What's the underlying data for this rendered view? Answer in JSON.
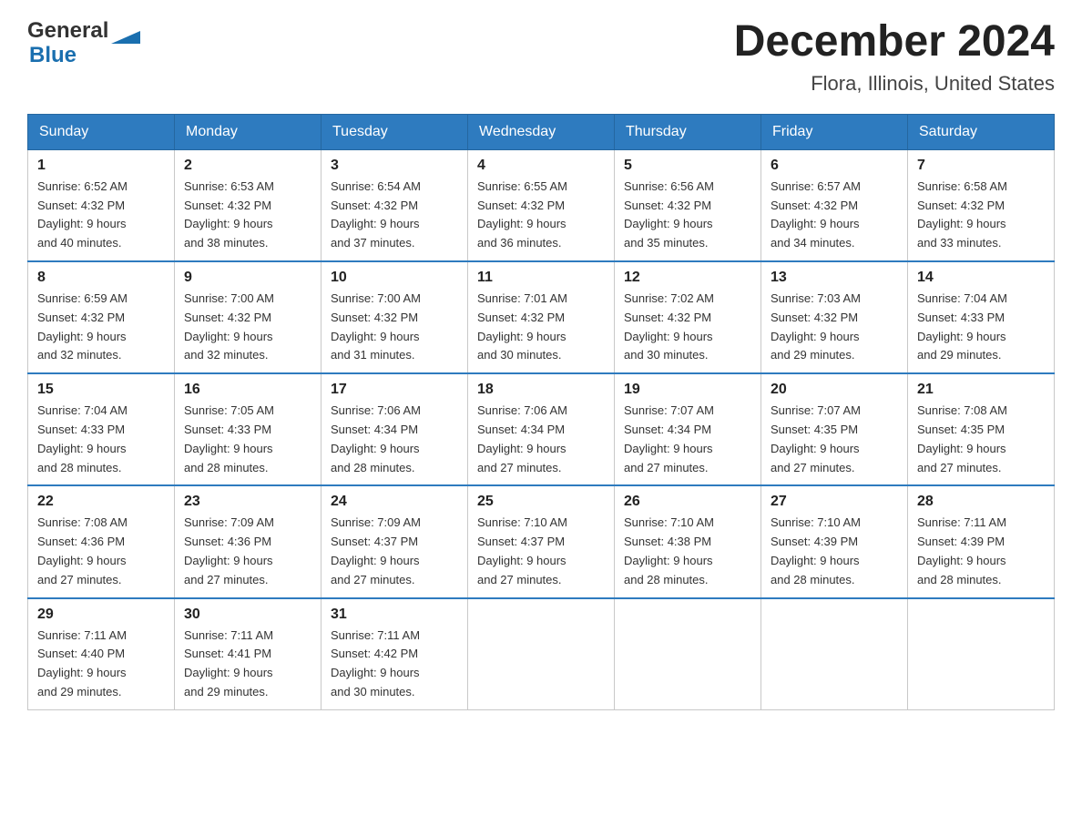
{
  "logo": {
    "text_general": "General",
    "text_blue": "Blue"
  },
  "title": {
    "month": "December 2024",
    "location": "Flora, Illinois, United States"
  },
  "weekdays": [
    "Sunday",
    "Monday",
    "Tuesday",
    "Wednesday",
    "Thursday",
    "Friday",
    "Saturday"
  ],
  "weeks": [
    [
      {
        "day": "1",
        "sunrise": "6:52 AM",
        "sunset": "4:32 PM",
        "daylight": "9 hours and 40 minutes."
      },
      {
        "day": "2",
        "sunrise": "6:53 AM",
        "sunset": "4:32 PM",
        "daylight": "9 hours and 38 minutes."
      },
      {
        "day": "3",
        "sunrise": "6:54 AM",
        "sunset": "4:32 PM",
        "daylight": "9 hours and 37 minutes."
      },
      {
        "day": "4",
        "sunrise": "6:55 AM",
        "sunset": "4:32 PM",
        "daylight": "9 hours and 36 minutes."
      },
      {
        "day": "5",
        "sunrise": "6:56 AM",
        "sunset": "4:32 PM",
        "daylight": "9 hours and 35 minutes."
      },
      {
        "day": "6",
        "sunrise": "6:57 AM",
        "sunset": "4:32 PM",
        "daylight": "9 hours and 34 minutes."
      },
      {
        "day": "7",
        "sunrise": "6:58 AM",
        "sunset": "4:32 PM",
        "daylight": "9 hours and 33 minutes."
      }
    ],
    [
      {
        "day": "8",
        "sunrise": "6:59 AM",
        "sunset": "4:32 PM",
        "daylight": "9 hours and 32 minutes."
      },
      {
        "day": "9",
        "sunrise": "7:00 AM",
        "sunset": "4:32 PM",
        "daylight": "9 hours and 32 minutes."
      },
      {
        "day": "10",
        "sunrise": "7:00 AM",
        "sunset": "4:32 PM",
        "daylight": "9 hours and 31 minutes."
      },
      {
        "day": "11",
        "sunrise": "7:01 AM",
        "sunset": "4:32 PM",
        "daylight": "9 hours and 30 minutes."
      },
      {
        "day": "12",
        "sunrise": "7:02 AM",
        "sunset": "4:32 PM",
        "daylight": "9 hours and 30 minutes."
      },
      {
        "day": "13",
        "sunrise": "7:03 AM",
        "sunset": "4:32 PM",
        "daylight": "9 hours and 29 minutes."
      },
      {
        "day": "14",
        "sunrise": "7:04 AM",
        "sunset": "4:33 PM",
        "daylight": "9 hours and 29 minutes."
      }
    ],
    [
      {
        "day": "15",
        "sunrise": "7:04 AM",
        "sunset": "4:33 PM",
        "daylight": "9 hours and 28 minutes."
      },
      {
        "day": "16",
        "sunrise": "7:05 AM",
        "sunset": "4:33 PM",
        "daylight": "9 hours and 28 minutes."
      },
      {
        "day": "17",
        "sunrise": "7:06 AM",
        "sunset": "4:34 PM",
        "daylight": "9 hours and 28 minutes."
      },
      {
        "day": "18",
        "sunrise": "7:06 AM",
        "sunset": "4:34 PM",
        "daylight": "9 hours and 27 minutes."
      },
      {
        "day": "19",
        "sunrise": "7:07 AM",
        "sunset": "4:34 PM",
        "daylight": "9 hours and 27 minutes."
      },
      {
        "day": "20",
        "sunrise": "7:07 AM",
        "sunset": "4:35 PM",
        "daylight": "9 hours and 27 minutes."
      },
      {
        "day": "21",
        "sunrise": "7:08 AM",
        "sunset": "4:35 PM",
        "daylight": "9 hours and 27 minutes."
      }
    ],
    [
      {
        "day": "22",
        "sunrise": "7:08 AM",
        "sunset": "4:36 PM",
        "daylight": "9 hours and 27 minutes."
      },
      {
        "day": "23",
        "sunrise": "7:09 AM",
        "sunset": "4:36 PM",
        "daylight": "9 hours and 27 minutes."
      },
      {
        "day": "24",
        "sunrise": "7:09 AM",
        "sunset": "4:37 PM",
        "daylight": "9 hours and 27 minutes."
      },
      {
        "day": "25",
        "sunrise": "7:10 AM",
        "sunset": "4:37 PM",
        "daylight": "9 hours and 27 minutes."
      },
      {
        "day": "26",
        "sunrise": "7:10 AM",
        "sunset": "4:38 PM",
        "daylight": "9 hours and 28 minutes."
      },
      {
        "day": "27",
        "sunrise": "7:10 AM",
        "sunset": "4:39 PM",
        "daylight": "9 hours and 28 minutes."
      },
      {
        "day": "28",
        "sunrise": "7:11 AM",
        "sunset": "4:39 PM",
        "daylight": "9 hours and 28 minutes."
      }
    ],
    [
      {
        "day": "29",
        "sunrise": "7:11 AM",
        "sunset": "4:40 PM",
        "daylight": "9 hours and 29 minutes."
      },
      {
        "day": "30",
        "sunrise": "7:11 AM",
        "sunset": "4:41 PM",
        "daylight": "9 hours and 29 minutes."
      },
      {
        "day": "31",
        "sunrise": "7:11 AM",
        "sunset": "4:42 PM",
        "daylight": "9 hours and 30 minutes."
      },
      null,
      null,
      null,
      null
    ]
  ],
  "labels": {
    "sunrise_prefix": "Sunrise: ",
    "sunset_prefix": "Sunset: ",
    "daylight_prefix": "Daylight: "
  }
}
